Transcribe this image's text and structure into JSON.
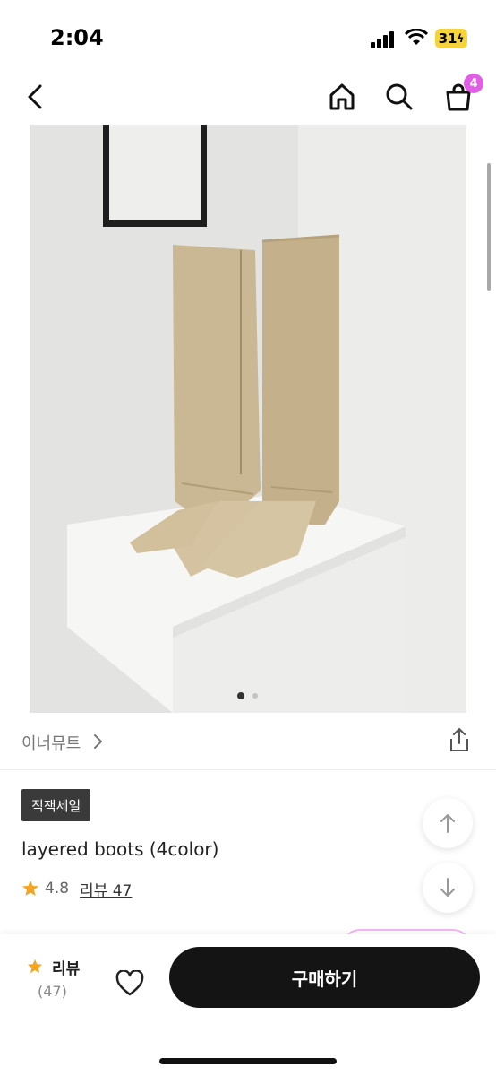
{
  "status_bar": {
    "time": "2:04",
    "battery": "31"
  },
  "nav": {
    "back_icon": "chevron-left-icon",
    "home_icon": "home-icon",
    "search_icon": "search-icon",
    "cart_icon": "shopping-bag-icon",
    "cart_count": "4"
  },
  "gallery": {
    "page_count": 2,
    "active_index": 0
  },
  "brand": {
    "name": "이너뮤트",
    "chevron": "›"
  },
  "product": {
    "sale_badge": "직잭세일",
    "title": "layered boots (4color)",
    "rating": "4.8",
    "review_link": "리뷰 47"
  },
  "bottom_bar": {
    "review_label": "리뷰",
    "review_count": "(47)",
    "buy_label": "구매하기"
  },
  "colors": {
    "accent": "#e25ee6",
    "buy_button": "#141414",
    "star": "#f4a522"
  }
}
